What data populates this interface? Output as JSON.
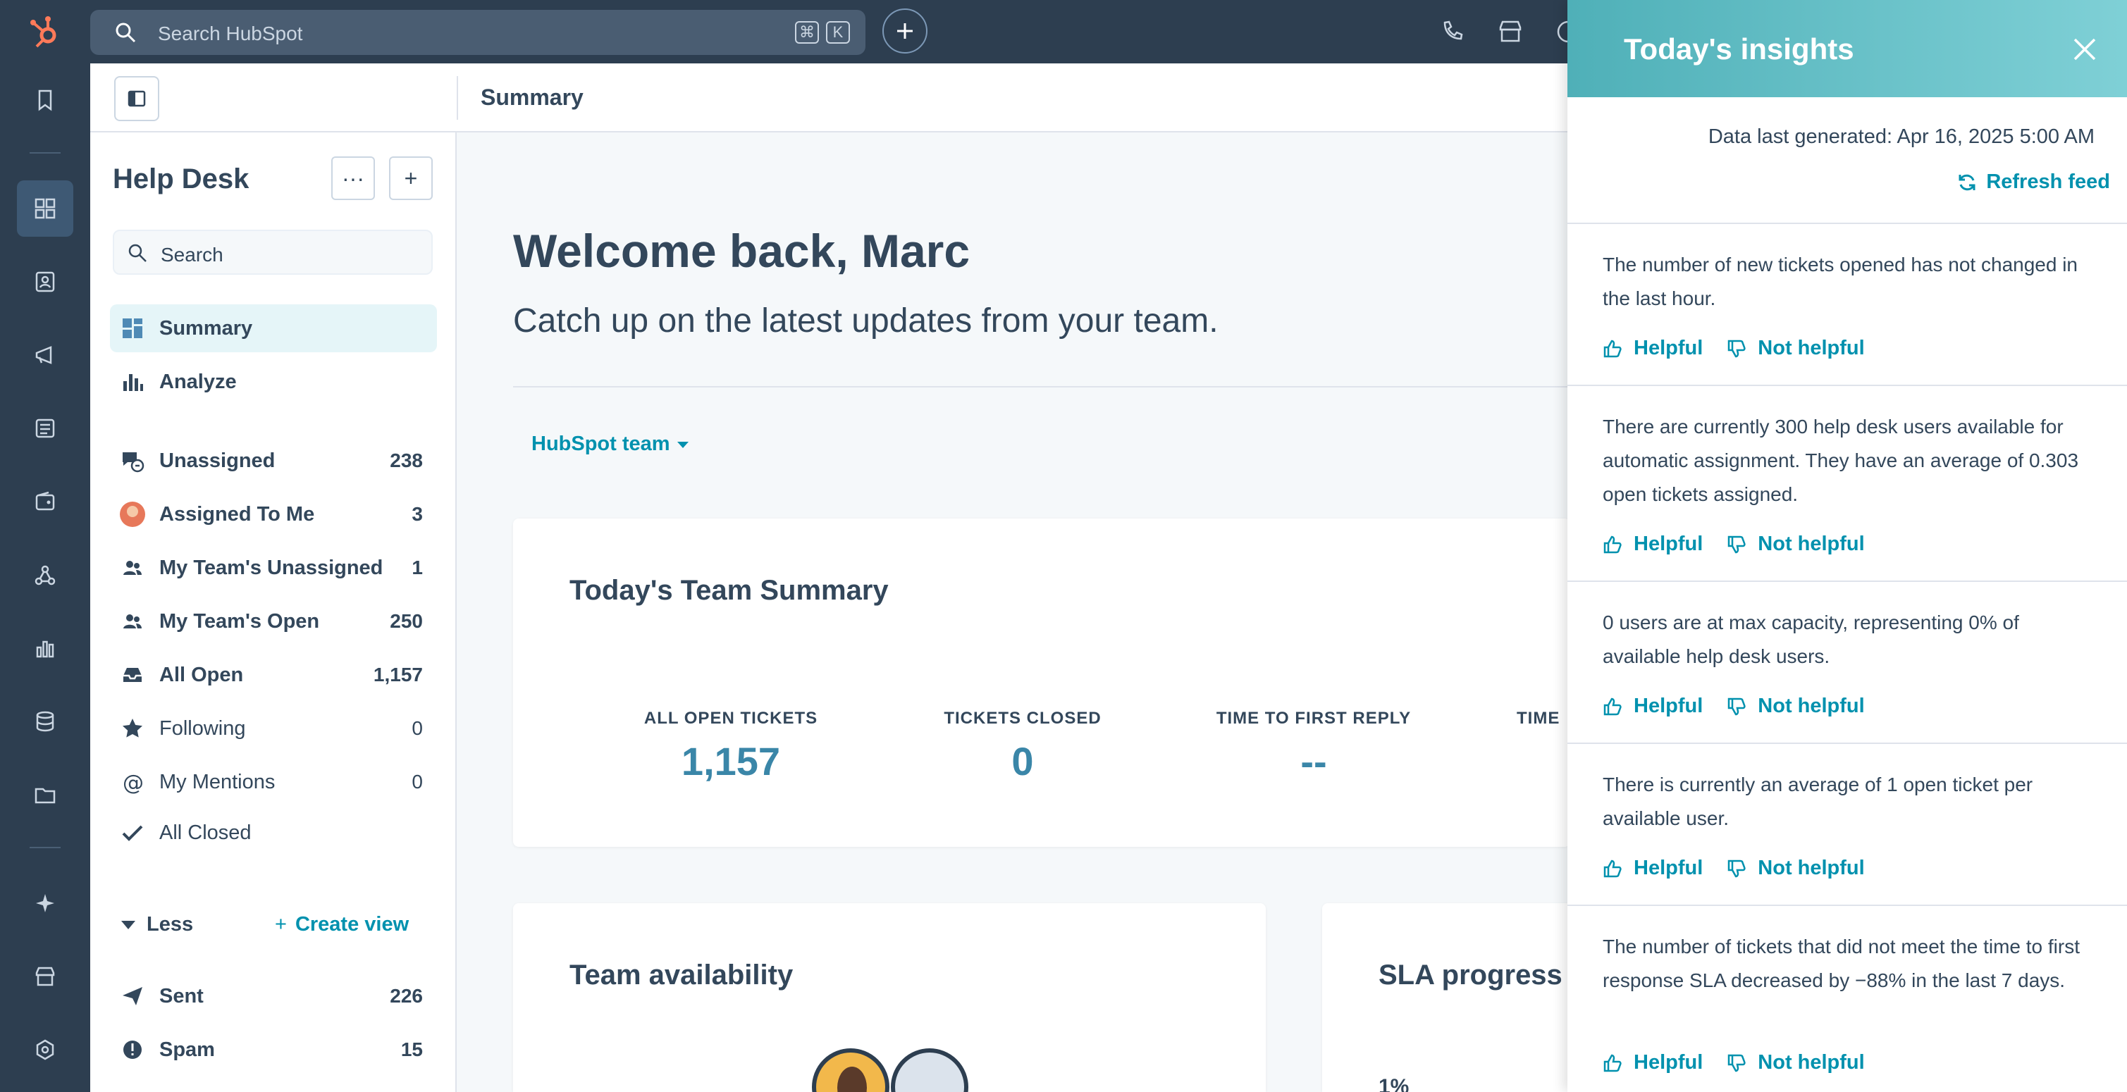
{
  "colors": {
    "rail": "#2d3e50",
    "accent": "#0091ae",
    "metric": "#3a86a8",
    "panel_header": "#4fb0b8"
  },
  "topbar": {
    "search_placeholder": "Search HubSpot",
    "shortcut_keys": [
      "⌘",
      "K"
    ]
  },
  "header": {
    "title": "Summary"
  },
  "sidebar": {
    "title": "Help Desk",
    "more_label": "···",
    "add_label": "+",
    "search_placeholder": "Search",
    "items": [
      {
        "label": "Summary",
        "icon": "dashboard-icon",
        "count": ""
      },
      {
        "label": "Analyze",
        "icon": "bar-chart-icon",
        "count": ""
      },
      {
        "label": "Unassigned",
        "icon": "chat-question-icon",
        "count": "238"
      },
      {
        "label": "Assigned To Me",
        "icon": "avatar",
        "count": "3"
      },
      {
        "label": "My Team's Unassigned",
        "icon": "team-icon",
        "count": "1"
      },
      {
        "label": "My Team's Open",
        "icon": "team-icon",
        "count": "250"
      },
      {
        "label": "All Open",
        "icon": "inbox-icon",
        "count": "1,157"
      },
      {
        "label": "Following",
        "icon": "star-icon",
        "count": "0"
      },
      {
        "label": "My Mentions",
        "icon": "at-icon",
        "count": "0"
      },
      {
        "label": "All Closed",
        "icon": "check-icon",
        "count": ""
      },
      {
        "label": "Sent",
        "icon": "send-icon",
        "count": "226"
      },
      {
        "label": "Spam",
        "icon": "alert-icon",
        "count": "15"
      }
    ],
    "less_label": "Less",
    "create_view_label": "Create view"
  },
  "main": {
    "welcome": "Welcome back, Marc",
    "subtitle": "Catch up on the latest updates from your team.",
    "team_filter": "HubSpot team",
    "summary_card": {
      "title": "Today's Team Summary",
      "metrics": [
        {
          "label": "ALL OPEN TICKETS",
          "value": "1,157"
        },
        {
          "label": "TICKETS CLOSED",
          "value": "0"
        },
        {
          "label": "TIME TO FIRST REPLY",
          "value": "--"
        },
        {
          "label": "TIME",
          "value": ""
        }
      ]
    },
    "availability_card": {
      "title": "Team availability"
    },
    "sla_card": {
      "title": "SLA progress",
      "value": "1%"
    }
  },
  "insights": {
    "title": "Today's insights",
    "generated": "Data last generated: Apr 16, 2025 5:00 AM",
    "refresh_label": "Refresh feed",
    "helpful_label": "Helpful",
    "not_helpful_label": "Not helpful",
    "items": [
      {
        "text": "The number of new tickets opened has not changed in the last hour."
      },
      {
        "text": "There are currently 300 help desk users available for automatic assignment. They have an average of 0.303 open tickets assigned."
      },
      {
        "text": "0 users are at max capacity, representing 0% of available help desk users."
      },
      {
        "text": "There is currently an average of 1 open ticket per available user."
      },
      {
        "text": "The number of tickets that did not meet the time to first response SLA decreased by −88% in the last 7 days."
      }
    ]
  }
}
